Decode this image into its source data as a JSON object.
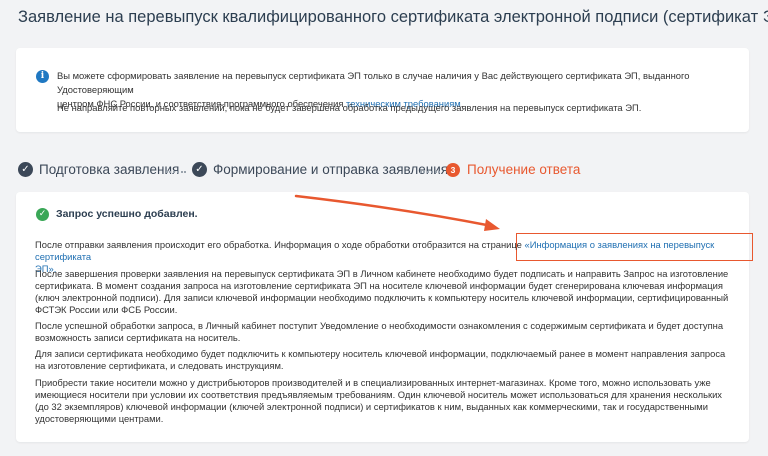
{
  "page": {
    "title": "Заявление на перевыпуск квалифицированного сертификата электронной подписи (сертификат ЭП)"
  },
  "info": {
    "line1": "Вы можете сформировать заявление на перевыпуск сертификата ЭП только в случае наличия у Вас действующего сертификата ЭП, выданного Удостоверяющим",
    "line2_prefix": "центром ФНС России, и соответствия программного обеспечения ",
    "link": "техническим требованиям",
    "line2_suffix": ".",
    "line3": "Не направляйте повторных заявлений, пока не будет завершена обработка предыдущего заявления на перевыпуск сертификата ЭП."
  },
  "steps": [
    {
      "label": "Подготовка заявления",
      "state": "done"
    },
    {
      "label": "Формирование и отправка заявления",
      "state": "done"
    },
    {
      "label": "Получение ответа",
      "state": "active",
      "number": "3"
    }
  ],
  "result": {
    "success": "Запрос успешно добавлен.",
    "p1_prefix": "После отправки заявления происходит его обработка. Информация о ходе обработки отобразится на странице ",
    "p1_link_a": "«Информация о заявлениях на перевыпуск сертификата",
    "p1_link_b": "ЭП».",
    "p2": "После завершения проверки заявления на перевыпуск сертификата ЭП в Личном кабинете необходимо будет подписать и направить Запрос на изготовление сертификата. В момент создания запроса на изготовление сертификата ЭП на носителе ключевой информации будет сгенерирована ключевая информация (ключ электронной подписи). Для записи ключевой информации необходимо подключить к компьютеру носитель ключевой информации, сертифицированный ФСТЭК России или ФСБ России.",
    "p3": "После успешной обработки запроса, в Личный кабинет поступит Уведомление о необходимости ознакомления с содержимым сертификата и будет доступна возможность записи сертификата на носитель.",
    "p4": "Для записи сертификата необходимо будет подключить к компьютеру носитель ключевой информации, подключаемый ранее в момент направления запроса на изготовление сертификата, и следовать инструкциям.",
    "p5": "Приобрести такие носители можно у дистрибьюторов производителей и в специализированных интернет-магазинах. Кроме того, можно использовать уже имеющиеся носители при условии их соответствия предъявляемым требованиям. Один ключевой носитель может использоваться для хранения нескольких (до 32 экземпляров) ключевой информации (ключей электронной подписи) и сертификатов к ним, выданных как коммерческими, так и государственными удостоверяющими центрами."
  },
  "colors": {
    "accent": "#e8582f",
    "link": "#1f6fb2",
    "success": "#3aa757",
    "info": "#1f78c2"
  },
  "icons": {
    "info": "info-icon",
    "success": "check-circle-icon",
    "step_done": "check-circle-icon",
    "annotation": "arrow-icon"
  }
}
